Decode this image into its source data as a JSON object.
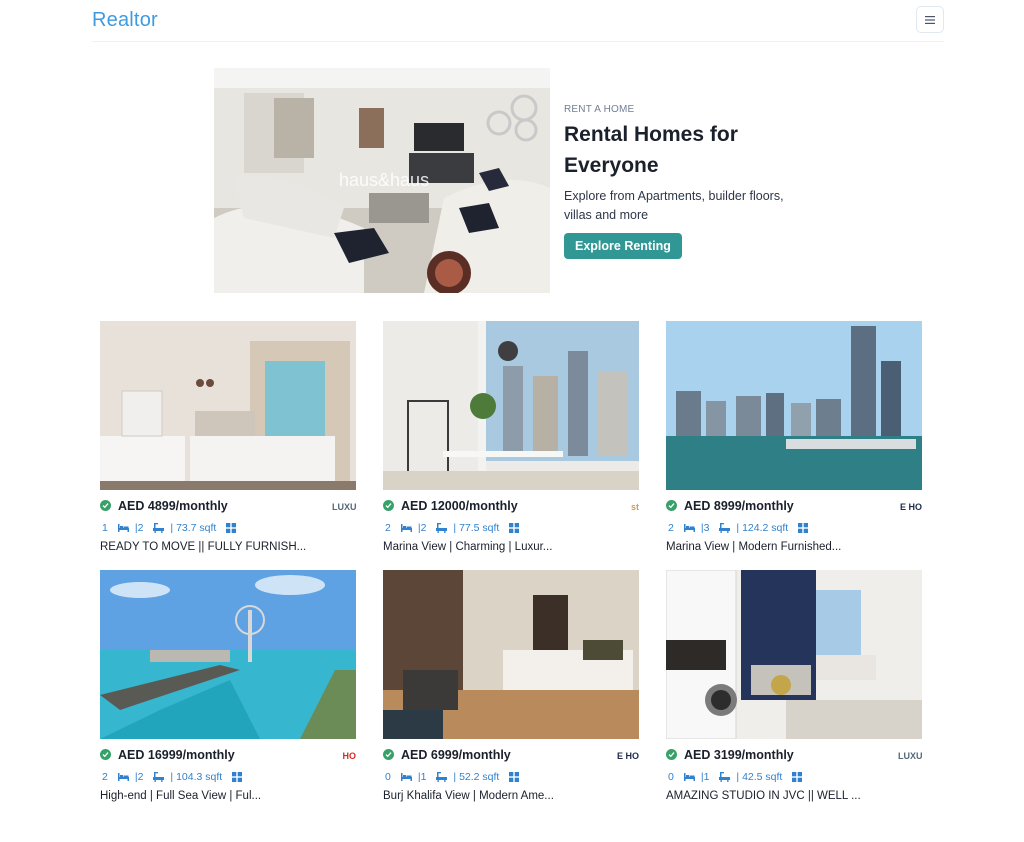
{
  "nav": {
    "brand": "Realtor",
    "menu_icon": "hamburger-icon"
  },
  "hero": {
    "kicker": "RENT A HOME",
    "title": "Rental Homes for Everyone",
    "description": "Explore from Apartments, builder floors, villas and more",
    "button": "Explore Renting",
    "image_watermark": "haus&haus"
  },
  "colors": {
    "brand": "#3f9be0",
    "accent": "#319795",
    "verified": "#38a169",
    "meta": "#3182ce"
  },
  "listings": [
    {
      "price": "AED 4899/monthly",
      "rooms": "1",
      "baths": "|2",
      "area": "| 73.7 sqft",
      "title": "READY TO MOVE || FULLY FURNISH...",
      "agency": "LUXURY"
    },
    {
      "price": "AED 12000/monthly",
      "rooms": "2",
      "baths": "|2",
      "area": "| 77.5 sqft",
      "title": "Marina View | Charming | Luxur...",
      "agency": "st"
    },
    {
      "price": "AED 8999/monthly",
      "rooms": "2",
      "baths": "|3",
      "area": "| 124.2 sqft",
      "title": "Marina View | Modern Furnished...",
      "agency": "E HO"
    },
    {
      "price": "AED 16999/monthly",
      "rooms": "2",
      "baths": "|2",
      "area": "| 104.3 sqft",
      "title": "High-end | Full Sea View | Ful...",
      "agency": "HO"
    },
    {
      "price": "AED 6999/monthly",
      "rooms": "0",
      "baths": "|1",
      "area": "| 52.2 sqft",
      "title": "Burj Khalifa View | Modern Ame...",
      "agency": "E HO"
    },
    {
      "price": "AED 3199/monthly",
      "rooms": "0",
      "baths": "|1",
      "area": "| 42.5 sqft",
      "title": "AMAZING STUDIO IN JVC || WELL ...",
      "agency": "LUXURY"
    }
  ],
  "icons": {
    "verified": "check-circle-icon",
    "bed": "bed-icon",
    "bath": "bath-icon",
    "area": "grid-area-icon"
  }
}
